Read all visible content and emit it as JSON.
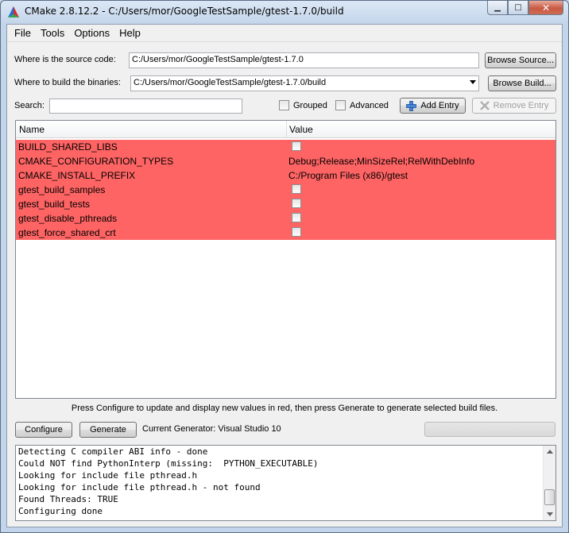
{
  "window": {
    "title": "CMake 2.8.12.2 - C:/Users/mor/GoogleTestSample/gtest-1.7.0/build",
    "minimize": "▁",
    "maximize": "□",
    "close": "✕"
  },
  "menu": [
    "File",
    "Tools",
    "Options",
    "Help"
  ],
  "source": {
    "label": "Where is the source code:",
    "value": "C:/Users/mor/GoogleTestSample/gtest-1.7.0",
    "browse": "Browse Source..."
  },
  "build": {
    "label": "Where to build the binaries:",
    "value": "C:/Users/mor/GoogleTestSample/gtest-1.7.0/build",
    "browse": "Browse Build..."
  },
  "search": {
    "label": "Search:",
    "value": "",
    "grouped": "Grouped",
    "advanced": "Advanced",
    "add_entry": "Add Entry",
    "remove_entry": "Remove Entry"
  },
  "table": {
    "columns": [
      "Name",
      "Value"
    ],
    "row_color": "#ff6464",
    "rows": [
      {
        "name": "BUILD_SHARED_LIBS",
        "value": "",
        "checkbox": true
      },
      {
        "name": "CMAKE_CONFIGURATION_TYPES",
        "value": "Debug;Release;MinSizeRel;RelWithDebInfo",
        "checkbox": false
      },
      {
        "name": "CMAKE_INSTALL_PREFIX",
        "value": "C:/Program Files (x86)/gtest",
        "checkbox": false
      },
      {
        "name": "gtest_build_samples",
        "value": "",
        "checkbox": true
      },
      {
        "name": "gtest_build_tests",
        "value": "",
        "checkbox": true
      },
      {
        "name": "gtest_disable_pthreads",
        "value": "",
        "checkbox": true
      },
      {
        "name": "gtest_force_shared_crt",
        "value": "",
        "checkbox": true
      }
    ]
  },
  "hint": "Press Configure to update and display new values in red, then press Generate to generate selected build files.",
  "actions": {
    "configure": "Configure",
    "generate": "Generate",
    "current_generator": "Current Generator: Visual Studio 10"
  },
  "output": [
    "Detecting C compiler ABI info - done",
    "Could NOT find PythonInterp (missing:  PYTHON_EXECUTABLE)",
    "Looking for include file pthread.h",
    "Looking for include file pthread.h - not found",
    "Found Threads: TRUE",
    "Configuring done"
  ]
}
